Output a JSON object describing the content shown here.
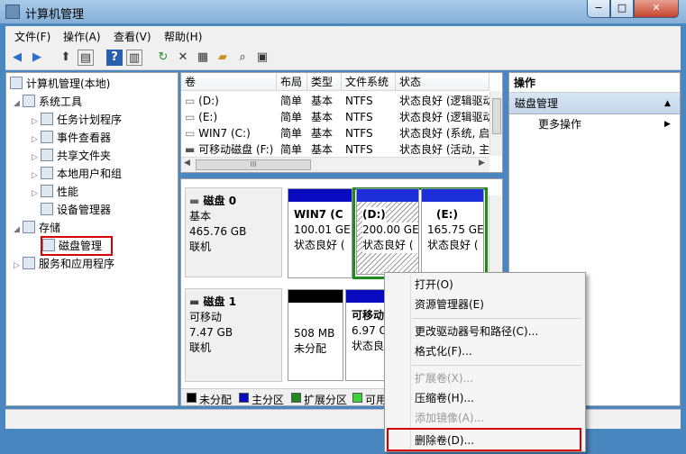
{
  "window": {
    "title": "计算机管理",
    "min_label": "−",
    "max_label": "□",
    "close_label": "✕"
  },
  "menu": [
    "文件(F)",
    "操作(A)",
    "查看(V)",
    "帮助(H)"
  ],
  "toolbar": [
    "back-icon",
    "forward-icon",
    "up-folder-icon",
    "show-tree-icon",
    "help-icon",
    "properties-pane-icon",
    "refresh-icon",
    "delete-icon",
    "properties-icon",
    "open-icon",
    "search-icon",
    "export-icon"
  ],
  "tree": {
    "root": "计算机管理(本地)",
    "system_tools": "系统工具",
    "task_scheduler": "任务计划程序",
    "event_viewer": "事件查看器",
    "shared_folders": "共享文件夹",
    "local_users": "本地用户和组",
    "performance": "性能",
    "device_manager": "设备管理器",
    "storage": "存储",
    "disk_management": "磁盘管理",
    "services_apps": "服务和应用程序"
  },
  "volumes": {
    "columns": [
      "卷",
      "布局",
      "类型",
      "文件系统",
      "状态"
    ],
    "rows": [
      [
        "(D:)",
        "简单",
        "基本",
        "NTFS",
        "状态良好 (逻辑驱动"
      ],
      [
        "(E:)",
        "简单",
        "基本",
        "NTFS",
        "状态良好 (逻辑驱动"
      ],
      [
        "WIN7 (C:)",
        "简单",
        "基本",
        "NTFS",
        "状态良好 (系统, 启"
      ],
      [
        "可移动磁盘 (F:)",
        "简单",
        "基本",
        "NTFS",
        "状态良好 (活动, 主"
      ]
    ],
    "scroll_grip": "III"
  },
  "disks": [
    {
      "name": "磁盘 0",
      "type": "基本",
      "size": "465.76 GB",
      "status": "联机",
      "partitions": [
        {
          "label": "WIN7  (C",
          "size": "100.01 GE",
          "status": "状态良好 ("
        },
        {
          "label": "(D:)",
          "size": "200.00 GE",
          "status": "状态良好 ("
        },
        {
          "label": "(E:)",
          "size": "165.75 GE",
          "status": "状态良好 ("
        }
      ]
    },
    {
      "name": "磁盘 1",
      "type": "可移动",
      "size": "7.47 GB",
      "status": "联机",
      "partitions": [
        {
          "label": "",
          "size": "508 MB",
          "status": "未分配"
        },
        {
          "label": "可移动磁",
          "size": "6.97 G",
          "status": "状态良好"
        }
      ]
    }
  ],
  "legend": [
    "未分配",
    "主分区",
    "扩展分区",
    "可用"
  ],
  "colors": {
    "unallocated": "#000000",
    "primary": "#0a0ac0",
    "extended": "#1f8a1f",
    "free": "#3cd23c",
    "logical": "#1c2fd8",
    "highlight": "#d60000"
  },
  "actions": {
    "header": "操作",
    "section": "磁盘管理",
    "more": "更多操作"
  },
  "context_menu": {
    "items": [
      {
        "label": "打开(O)",
        "enabled": true
      },
      {
        "label": "资源管理器(E)",
        "enabled": true
      },
      {
        "label": "更改驱动器号和路径(C)...",
        "enabled": true
      },
      {
        "label": "格式化(F)...",
        "enabled": true
      },
      {
        "label": "扩展卷(X)...",
        "enabled": false
      },
      {
        "label": "压缩卷(H)...",
        "enabled": true
      },
      {
        "label": "添加镜像(A)...",
        "enabled": false
      },
      {
        "label": "删除卷(D)...",
        "enabled": true
      }
    ]
  }
}
